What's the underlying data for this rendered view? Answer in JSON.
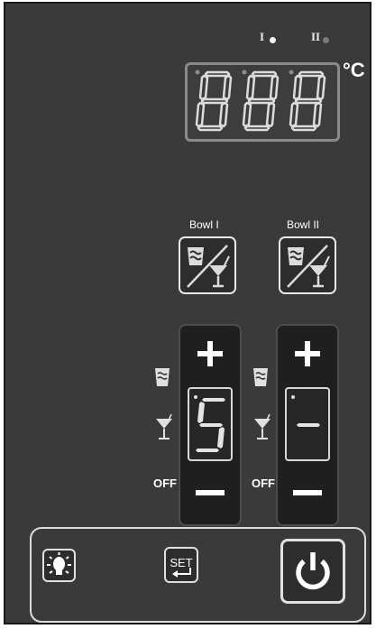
{
  "indicators": {
    "one_label": "I",
    "two_label": "II",
    "one_color": "#f2f2f2",
    "two_color": "#7a7a7a"
  },
  "temperature": {
    "display_value": "888",
    "unit": "°C"
  },
  "bowls": [
    {
      "label": "Bowl I",
      "mode_icon": "glass-cocktail-icon"
    },
    {
      "label": "Bowl II",
      "mode_icon": "glass-cocktail-icon"
    }
  ],
  "channels": [
    {
      "plus": "plus-icon",
      "minus": "minus-icon",
      "display_value": "5"
    },
    {
      "plus": "plus-icon",
      "minus": "minus-icon",
      "display_value": "-"
    }
  ],
  "side_labels": {
    "off": "OFF"
  },
  "controls": {
    "light_icon": "light-bulb-icon",
    "set_label": "SET",
    "power_icon": "power-icon"
  },
  "colors": {
    "panel": "#3a3a3a",
    "strip": "#1f1f1f",
    "text": "#ffffff"
  }
}
